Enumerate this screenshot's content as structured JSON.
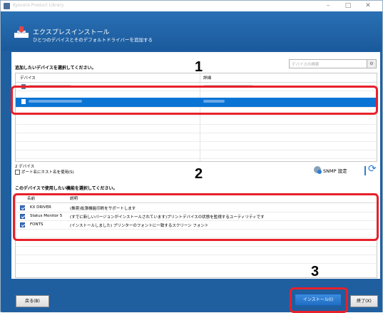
{
  "window": {
    "title": "Kyocera Product Library",
    "minimize": "–",
    "maximize": "□",
    "close": "✕"
  },
  "header": {
    "title": "エクスプレスインストール",
    "subtitle": "ひとつのデバイスとそのデフォルトドライバーを追加する"
  },
  "devices": {
    "section_label": "追加したいデバイスを選択してください。",
    "search_placeholder": "デバイスの検索",
    "columns": [
      "デバイス",
      "詳細"
    ],
    "count_text": "2 デバイス",
    "host_checkbox_label": "ポート名にホスト名を使用(S)",
    "snmp_label": "SNMP 設定"
  },
  "features": {
    "section_label": "このデバイスで使用したい機能を選択してください。",
    "columns": [
      "名前",
      "説明"
    ],
    "rows": [
      {
        "name": "KX DRIVER",
        "description": "(推奨)拡張機能印刷をサポートします",
        "checked": true
      },
      {
        "name": "Status Monitor 5",
        "description": "(すでに新しいバージョンがインストールされています)プリントデバイスの状態を監視するユーティリティです",
        "checked": true
      },
      {
        "name": "FONTS",
        "description": "(インストールしました) プリンターのフォントに一致するスクリーン フォント",
        "checked": true
      }
    ]
  },
  "footer": {
    "back_label": "戻る(B)",
    "install_label": "インストール(I)",
    "exit_label": "終了(X)"
  },
  "markers": [
    "1",
    "2",
    "3"
  ],
  "colors": {
    "accent": "#1f5fa0",
    "selection": "#0a74d4",
    "highlight": "#e8202a"
  },
  "icons": {
    "refresh": "refresh-icon",
    "snmp": "snmp-settings-icon",
    "search": "search-icon"
  }
}
